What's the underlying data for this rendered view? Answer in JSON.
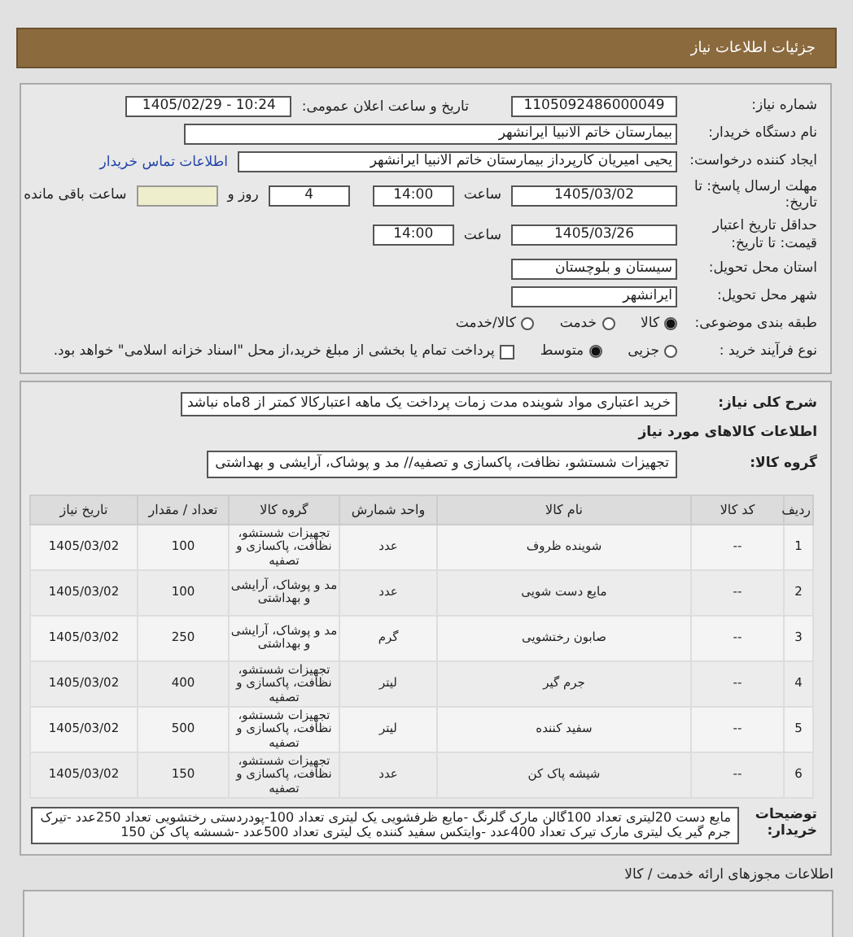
{
  "header": {
    "title": "جزئیات اطلاعات نیاز"
  },
  "need_number": {
    "label": "شماره نیاز:",
    "value": "1105092486000049"
  },
  "announce": {
    "label": "تاریخ و ساعت اعلان عمومی:",
    "value": "1405/02/29 - 10:24"
  },
  "buyer": {
    "label": "نام دستگاه خریدار:",
    "value": "بیمارستان خاتم الانبیا ایرانشهر"
  },
  "requester": {
    "label": "ایجاد کننده درخواست:",
    "value": "یحیی امیریان کارپرداز بیمارستان خاتم الانبیا ایرانشهر",
    "link": "اطلاعات تماس خریدار"
  },
  "deadline": {
    "label": "مهلت ارسال پاسخ: تا تاریخ:",
    "date": "1405/03/02",
    "time_label": "ساعت",
    "time": "14:00",
    "days": "4",
    "days_label": "روز و",
    "remaining_label": "ساعت باقی مانده"
  },
  "validity": {
    "label": "حداقل تاریخ اعتبار قیمت: تا تاریخ:",
    "date": "1405/03/26",
    "time_label": "ساعت",
    "time": "14:00"
  },
  "province": {
    "label": "استان محل تحویل:",
    "value": "سیستان و بلوچستان"
  },
  "city": {
    "label": "شهر محل تحویل:",
    "value": "ایرانشهر"
  },
  "category": {
    "label": "طبقه بندی موضوعی:",
    "options": [
      {
        "label": "کالا",
        "selected": true
      },
      {
        "label": "خدمت",
        "selected": false
      },
      {
        "label": "کالا/خدمت",
        "selected": false
      }
    ]
  },
  "process": {
    "label": "نوع فرآیند خرید :",
    "options": [
      {
        "label": "جزیی",
        "selected": false
      },
      {
        "label": "متوسط",
        "selected": true
      }
    ],
    "treasury": {
      "label": "پرداخت تمام یا بخشی از مبلغ خرید،از محل \"اسناد خزانه اسلامی\" خواهد بود.",
      "checked": false
    }
  },
  "description": {
    "label": "شرح کلی نیاز:",
    "value": "خرید اعتباری مواد شوینده مدت زمات پرداخت یک ماهه اعتبارکالا کمتر از 8ماه نباشد"
  },
  "goods_title": "اطلاعات کالاهای مورد نیاز",
  "goods_group": {
    "label": "گروه کالا:",
    "value": "تجهیزات شستشو، نظافت، پاکسازی و تصفیه// مد و پوشاک، آرایشی و بهداشتی"
  },
  "table": {
    "columns": [
      "ردیف",
      "کد کالا",
      "نام کالا",
      "واحد شمارش",
      "گروه کالا",
      "تعداد / مقدار",
      "تاریخ نیاز"
    ],
    "rows": [
      [
        "1",
        "--",
        "شوینده ظروف",
        "عدد",
        "تجهیزات شستشو، نظافت، پاکسازی و تصفیه",
        "100",
        "1405/03/02"
      ],
      [
        "2",
        "--",
        "مایع دست شویی",
        "عدد",
        "مد و پوشاک، آرایشی و بهداشتی",
        "100",
        "1405/03/02"
      ],
      [
        "3",
        "--",
        "صابون رختشویی",
        "گرم",
        "مد و پوشاک، آرایشی و بهداشتی",
        "250",
        "1405/03/02"
      ],
      [
        "4",
        "--",
        "جرم گیر",
        "لیتر",
        "تجهیزات شستشو، نظافت، پاکسازی و تصفیه",
        "400",
        "1405/03/02"
      ],
      [
        "5",
        "--",
        "سفید کننده",
        "لیتر",
        "تجهیزات شستشو، نظافت، پاکسازی و تصفیه",
        "500",
        "1405/03/02"
      ],
      [
        "6",
        "--",
        "شیشه پاک کن",
        "عدد",
        "تجهیزات شستشو، نظافت، پاکسازی و تصفیه",
        "150",
        "1405/03/02"
      ]
    ]
  },
  "buyer_notes": {
    "label": "توضیحات خریدار:",
    "value": "مایع دست 20لیتری تعداد 100گالن مارک گلرنگ -مایع ظرفشویی یک لیتری تعداد 100-پودردستی رختشویی تعداد 250عدد -تیرک جرم گیر یک لیتری مارک تیرک تعداد 400عدد -وایتکس سفید کننده یک لیتری تعداد 500عدد -شسشه پاک کن 150"
  },
  "licenses_title": "اطلاعات مجوزهای ارائه خدمت / کالا"
}
